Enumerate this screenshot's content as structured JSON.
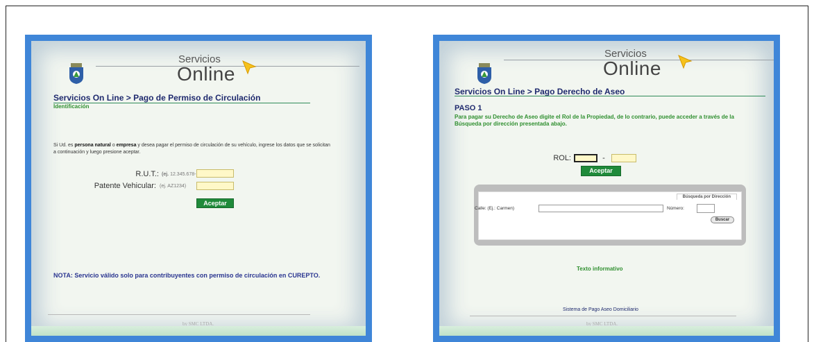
{
  "left": {
    "brand": {
      "top": "Servicios",
      "main": "Online"
    },
    "breadcrumb": {
      "root": "Servicios On Line",
      "sep": " > ",
      "current": "Pago de Permiso de Circulación"
    },
    "section": "Identificación",
    "instructions": {
      "p1": "Si Ud. es ",
      "b1": "persona natural",
      "p2": " o ",
      "b2": "empresa",
      "p3": " y desea pagar el permiso de circulación de su vehículo, ingrese los datos que se solicitan a continuación y luego presione aceptar."
    },
    "rut": {
      "label": "R.U.T.:",
      "hint_bold": "(ej.",
      "hint": "12.345.678-K)",
      "value": ""
    },
    "patente": {
      "label": "Patente Vehicular:",
      "hint": "(ej. AZ1234)",
      "value": ""
    },
    "accept_label": "Aceptar",
    "nota": "NOTA: Servicio válido solo para contribuyentes con permiso de circulación en CUREPTO.",
    "footer_by": "by SMC LTDA."
  },
  "right": {
    "brand": {
      "top": "Servicios",
      "main": "Online"
    },
    "breadcrumb": {
      "root": "Servicios On Line",
      "sep": " > ",
      "current": "Pago Derecho de Aseo"
    },
    "paso": "PASO 1",
    "instructions": "Para pagar su Derecho de Aseo digite el Rol de la Propiedad, de lo contrario, puede acceder a través de la Búsqueda por dirección presentada abajo.",
    "rol": {
      "label": "ROL:",
      "sep": "-",
      "value1": "",
      "value2": ""
    },
    "accept_label": "Aceptar",
    "search": {
      "tab": "Búsqueda por Dirección",
      "street_label": "Calle: (Ej.: Carmen)",
      "number_label": "Número:",
      "street_value": "",
      "number_value": "",
      "button": "Buscar"
    },
    "info": "Texto informativo",
    "system": "Sistema de Pago Aseo Domiciliario",
    "footer_by": "by SMC LTDA."
  },
  "colors": {
    "frame": "#3f86d8",
    "accent_green": "#1f8a3a",
    "title_blue": "#1f2a6e",
    "input_yellow": "#fff8c8"
  }
}
